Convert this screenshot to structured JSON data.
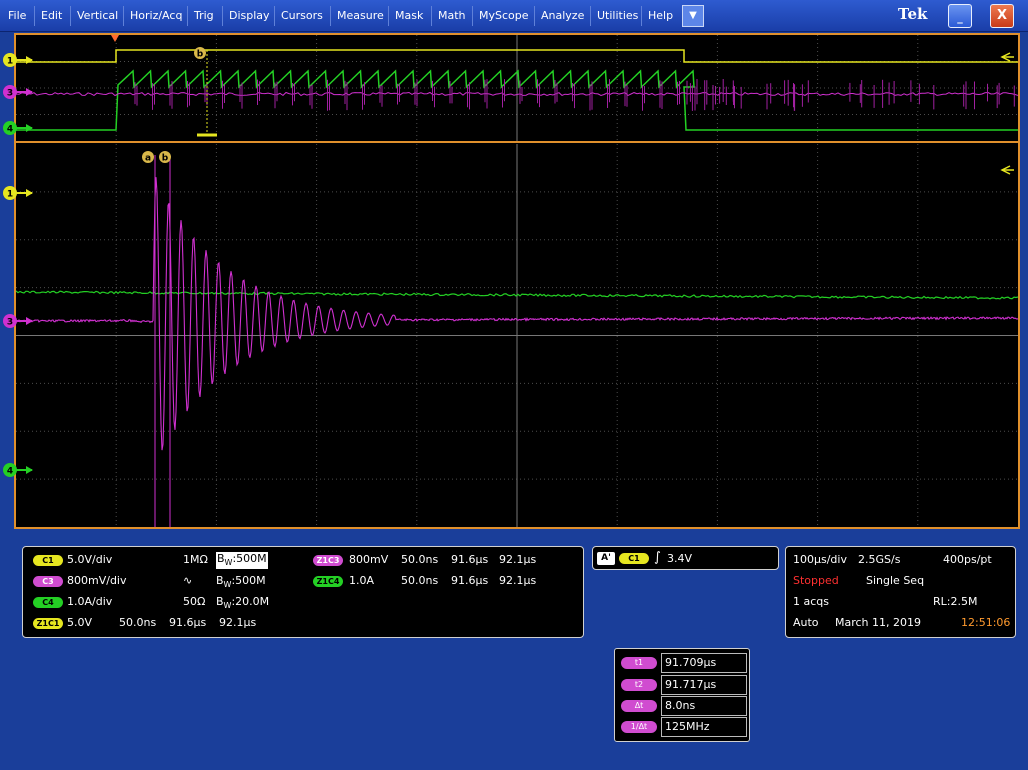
{
  "menu": {
    "items": [
      "File",
      "Edit",
      "Vertical",
      "Horiz/Acq",
      "Trig",
      "Display",
      "Cursors",
      "Measure",
      "Mask",
      "Math",
      "MyScope",
      "Analyze",
      "Utilities",
      "Help"
    ],
    "dropdown_icon": "▼",
    "brand": "Tek",
    "brand_ghost": "",
    "minimize": "_",
    "close": "X"
  },
  "display": {
    "markers": {
      "ch1_overview": "1",
      "ch3_overview": "3",
      "ch4_overview": "4",
      "ch1_main": "1",
      "ch3_main": "3",
      "ch4_main": "4",
      "cursor_a": "a",
      "cursor_b": "b",
      "cursor_b_overview": "b"
    },
    "colors": {
      "ch1": "#e6e620",
      "ch3": "#d030d0",
      "ch4": "#24d024",
      "frame": "#e0902c",
      "grid": "#5a5a5a"
    }
  },
  "channels": {
    "c1": {
      "badge": "C1",
      "scale": "5.0V/div",
      "coupling": "1MΩ",
      "bw_prefix": "B",
      "bw_sub": "W",
      "bw": ":500M"
    },
    "c3": {
      "badge": "C3",
      "scale": "800mV/div",
      "coupling_icon": "∿",
      "bw_prefix": "B",
      "bw_sub": "W",
      "bw": ":500M"
    },
    "c4": {
      "badge": "C4",
      "scale": "1.0A/div",
      "coupling": "50Ω",
      "bw_prefix": "B",
      "bw_sub": "W",
      "bw": ":20.0M"
    },
    "z1c1": {
      "badge": "Z1C1",
      "scale": "5.0V",
      "zoom_scale": "50.0ns",
      "start": "91.6µs",
      "end": "92.1µs"
    },
    "z1c3": {
      "badge": "Z1C3",
      "scale": "800mV",
      "zoom_scale": "50.0ns",
      "start": "91.6µs",
      "end": "92.1µs"
    },
    "z1c4": {
      "badge": "Z1C4",
      "scale": "1.0A",
      "zoom_scale": "50.0ns",
      "start": "91.6µs",
      "end": "92.1µs"
    }
  },
  "trigger": {
    "mode_badge": "A'",
    "source_badge": "C1",
    "slope_icon": "∫",
    "level": "3.4V"
  },
  "acquisition": {
    "time_div": "100µs/div",
    "sample_rate": "2.5GS/s",
    "resolution": "400ps/pt",
    "state": "Stopped",
    "mode": "Single Seq",
    "acqs": "1 acqs",
    "record_length": "RL:2.5M",
    "trigger_mode": "Auto",
    "date": "March 11, 2019",
    "time": "12:51:06"
  },
  "cursors": {
    "t1": {
      "label": "t1",
      "value": "91.709µs"
    },
    "t2": {
      "label": "t2",
      "value": "91.717µs"
    },
    "dt": {
      "label": "Δt",
      "value": "8.0ns"
    },
    "inv_dt": {
      "label": "1/Δt",
      "value": "125MHz"
    }
  }
}
